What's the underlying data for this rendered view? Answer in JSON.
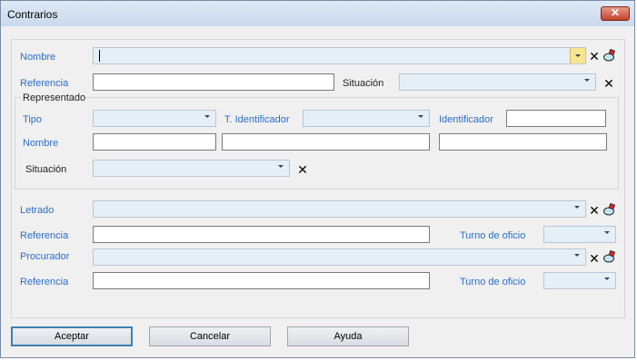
{
  "window": {
    "title": "Contrarios",
    "close_glyph": "✕"
  },
  "fields": {
    "nombre_label": "Nombre",
    "referencia_label": "Referencia",
    "situacion_label": "Situación"
  },
  "representado": {
    "group_label": "Representado",
    "tipo_label": "Tipo",
    "t_identificador_label": "T. Identificador",
    "identificador_label": "Identificador",
    "nombre_label": "Nombre",
    "situacion_label": "Situación"
  },
  "letrado": {
    "label": "Letrado",
    "referencia_label": "Referencia",
    "turno_label": "Turno de oficio"
  },
  "procurador": {
    "label": "Procurador",
    "referencia_label": "Referencia",
    "turno_label": "Turno de oficio"
  },
  "buttons": {
    "accept": "Aceptar",
    "cancel": "Cancelar",
    "help": "Ayuda"
  },
  "icons": {
    "clear": "clear-x-icon",
    "eraser": "eraser-icon"
  },
  "colors": {
    "label_blue": "#2a6ec7",
    "combo_bg": "#e5eff8",
    "accent": "#3c7fb1"
  }
}
